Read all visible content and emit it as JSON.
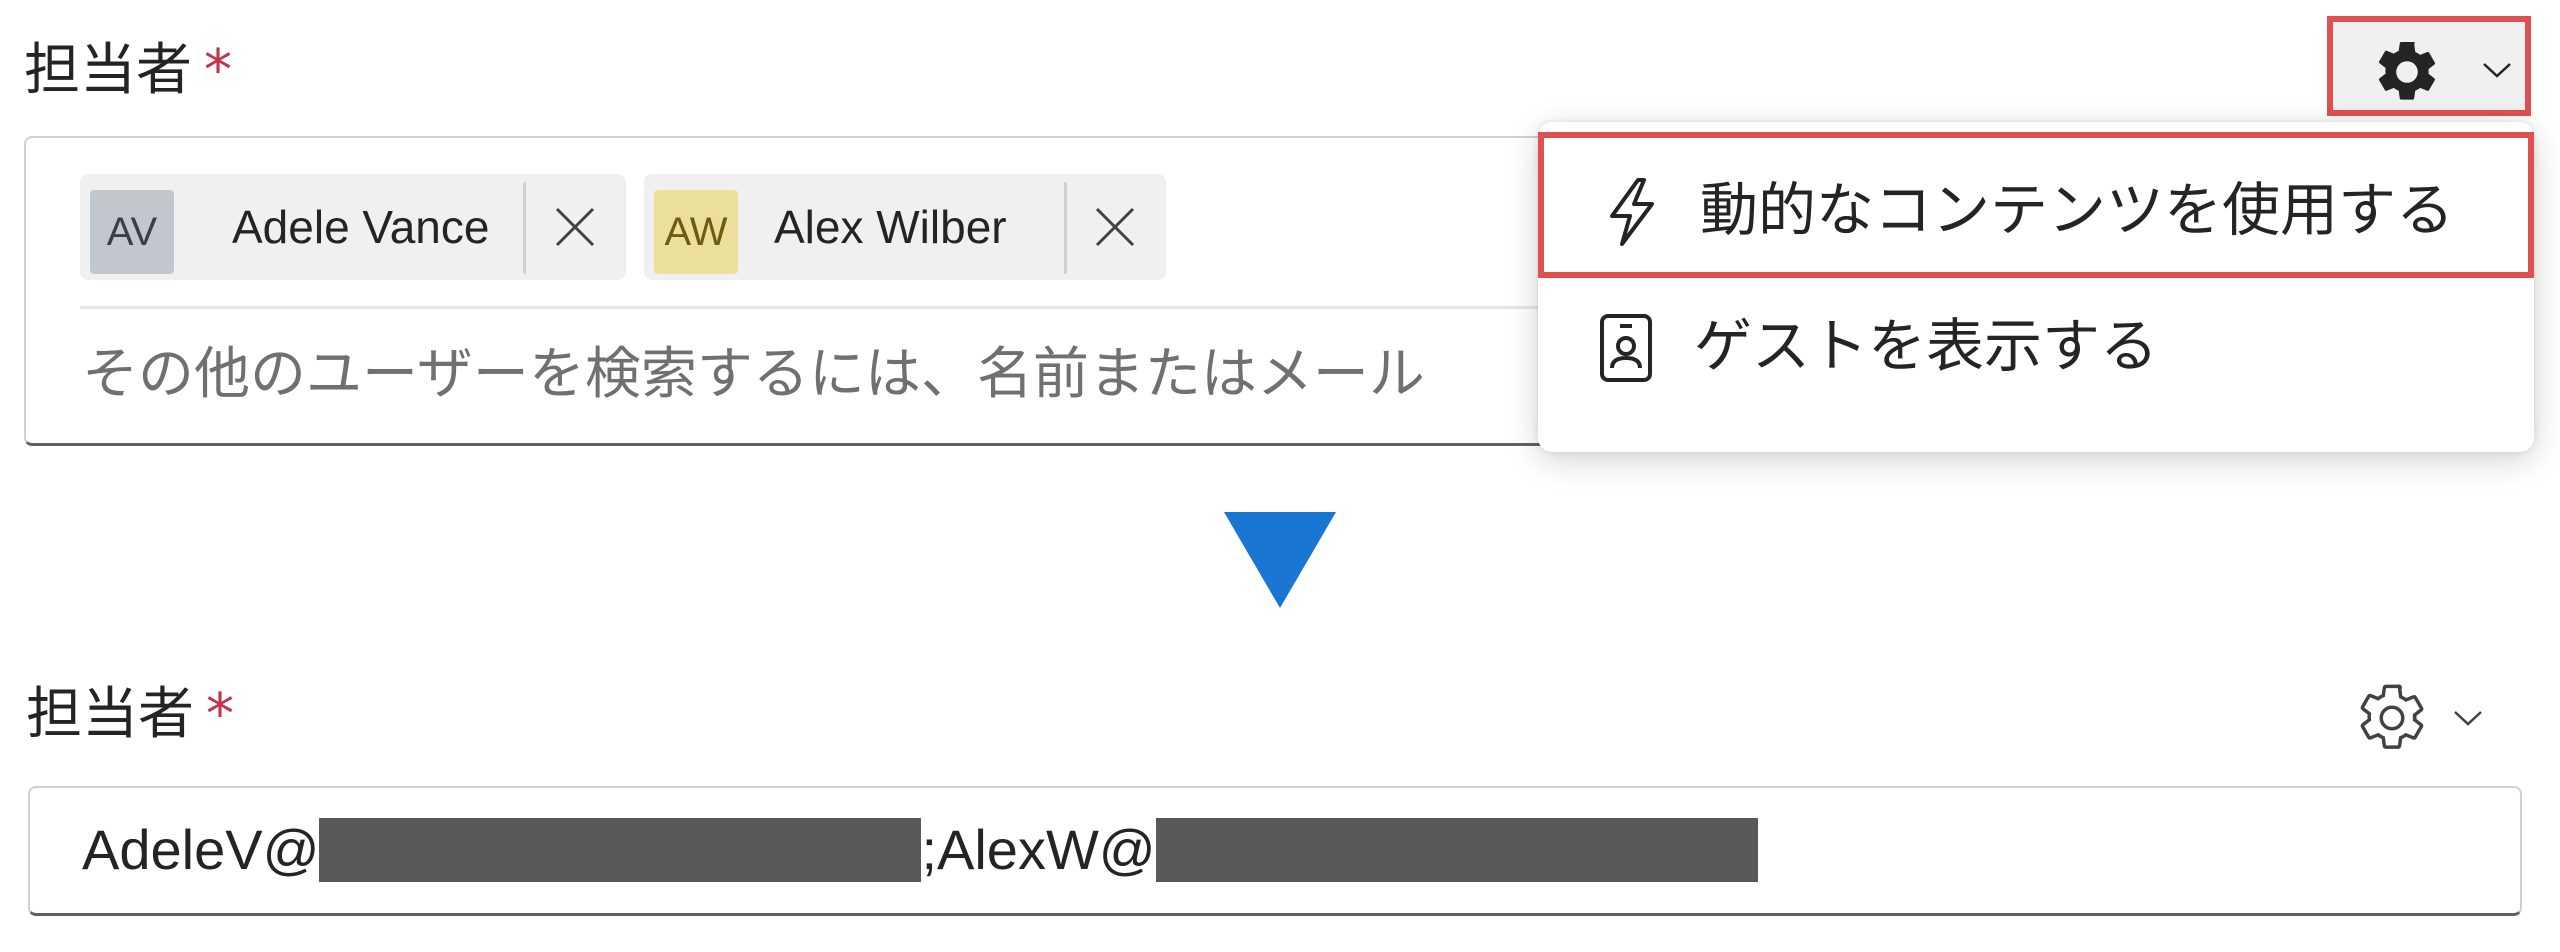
{
  "assignee_field": {
    "label": "担当者",
    "required_mark": "*",
    "chips": [
      {
        "initials": "AV",
        "name": "Adele Vance",
        "avatar_color": "#c1c7cc"
      },
      {
        "initials": "AW",
        "name": "Alex Wilber",
        "avatar_color": "#ebe09b"
      }
    ],
    "placeholder": "その他のユーザーを検索するには、名前またはメール"
  },
  "settings_menu": {
    "items": [
      {
        "label": "動的なコンテンツを使用する",
        "icon": "lightning-icon",
        "highlighted": true
      },
      {
        "label": "ゲストを表示する",
        "icon": "contact-card-icon",
        "highlighted": false
      }
    ]
  },
  "highlight_color": "#e05050",
  "arrow_color": "#1976d2",
  "assignee_field_after": {
    "label": "担当者",
    "required_mark": "*",
    "email_prefix_1": "AdeleV@",
    "separator": ";",
    "email_prefix_2": "AlexW@"
  }
}
